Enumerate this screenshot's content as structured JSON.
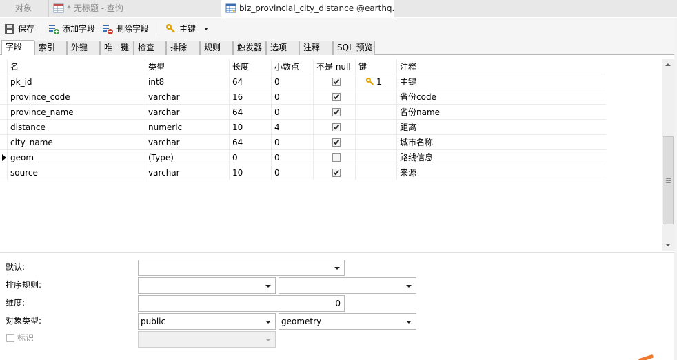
{
  "doc_tabs": [
    {
      "label": "对象"
    },
    {
      "label": "* 无标题 - 查询"
    },
    {
      "label": "biz_provincial_city_distance @earthq..."
    }
  ],
  "toolbar": {
    "save": "保存",
    "add_field": "添加字段",
    "delete_field": "删除字段",
    "primary_key": "主键"
  },
  "sub_tabs": [
    "字段",
    "索引",
    "外键",
    "唯一键",
    "检查",
    "排除",
    "规则",
    "触发器",
    "选项",
    "注释",
    "SQL 预览"
  ],
  "columns": [
    "名",
    "类型",
    "长度",
    "小数点",
    "不是 null",
    "键",
    "注释"
  ],
  "rows": [
    {
      "name": "pk_id",
      "type": "int8",
      "length": "64",
      "decimal": "0",
      "not_null": true,
      "key": "1",
      "comment": "主键"
    },
    {
      "name": "province_code",
      "type": "varchar",
      "length": "16",
      "decimal": "0",
      "not_null": true,
      "key": "",
      "comment": "省份code"
    },
    {
      "name": "province_name",
      "type": "varchar",
      "length": "64",
      "decimal": "0",
      "not_null": true,
      "key": "",
      "comment": "省份name"
    },
    {
      "name": "distance",
      "type": "numeric",
      "length": "10",
      "decimal": "4",
      "not_null": true,
      "key": "",
      "comment": "距离"
    },
    {
      "name": "city_name",
      "type": "varchar",
      "length": "64",
      "decimal": "0",
      "not_null": true,
      "key": "",
      "comment": "城市名称"
    },
    {
      "name": "geom",
      "type": "(Type)",
      "length": "0",
      "decimal": "0",
      "not_null": false,
      "key": "",
      "comment": "路线信息"
    },
    {
      "name": "source",
      "type": "varchar",
      "length": "10",
      "decimal": "0",
      "not_null": true,
      "key": "",
      "comment": "来源"
    }
  ],
  "properties": {
    "default_label": "默认:",
    "default_value": "",
    "collation_label": "排序规则:",
    "collation_value_1": "",
    "collation_value_2": "",
    "dimension_label": "维度:",
    "dimension_value": "0",
    "object_type_label": "对象类型:",
    "object_type_schema": "public",
    "object_type_name": "geometry",
    "identity_label": "标识",
    "identity_value": ""
  },
  "colors": {
    "key_icon": "#e2a400",
    "active_tab_bg": "#ffffff",
    "accent_orange": "#f07a2f"
  }
}
